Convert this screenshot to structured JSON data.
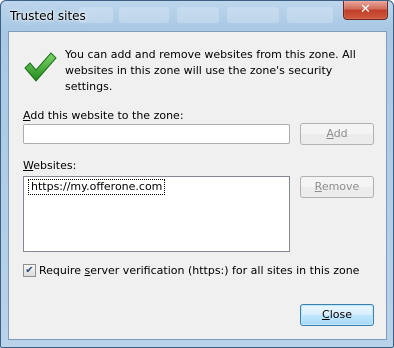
{
  "window": {
    "title": "Trusted sites",
    "close_glyph": "✕",
    "icon": "close-icon"
  },
  "info": {
    "icon": "green-checkmark-icon",
    "text": "You can add and remove websites from this zone. All websites in this zone will use the zone's security settings."
  },
  "add_site": {
    "label_accel": "A",
    "label_rest": "dd this website to the zone:",
    "value": "",
    "button_accel": "A",
    "button_rest": "dd"
  },
  "websites": {
    "label_accel": "W",
    "label_rest": "ebsites:",
    "items": [
      "https://my.offerone.com"
    ],
    "remove_accel": "R",
    "remove_rest": "emove"
  },
  "require": {
    "checked": true,
    "check_glyph": "✔",
    "label_before": "Require ",
    "label_accel": "s",
    "label_after": "erver verification (https:) for all sites in this zone"
  },
  "footer": {
    "close_accel": "C",
    "close_rest": "lose"
  },
  "colors": {
    "titlebar": "#a9c8e4",
    "client_bg": "#f0f0f0",
    "check_green": "#34a02a",
    "primary_border": "#3c7fb1"
  }
}
